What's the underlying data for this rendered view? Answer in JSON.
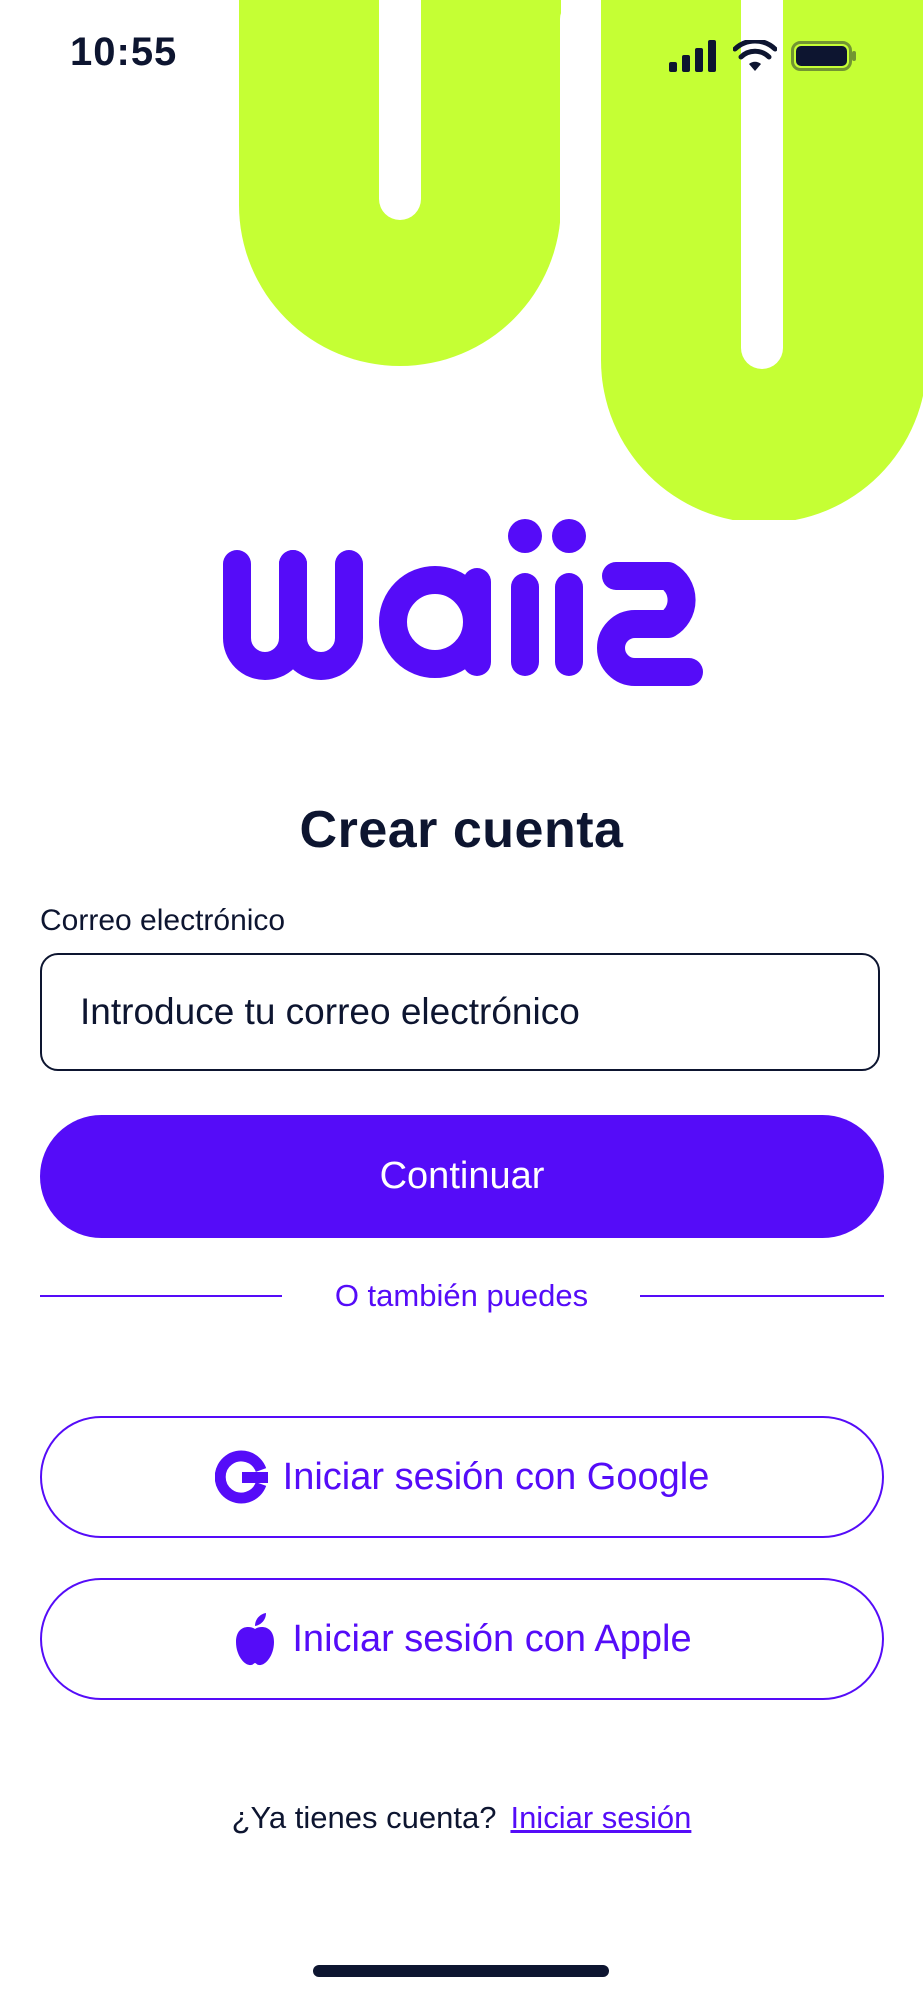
{
  "status_bar": {
    "time": "10:55",
    "icons": [
      "signal-icon",
      "wifi-icon",
      "battery-icon"
    ]
  },
  "brand": {
    "logo_text": "waiis",
    "accent_color": "#550cf8",
    "decor_color": "#c5ff34"
  },
  "page": {
    "title": "Crear cuenta"
  },
  "email": {
    "label": "Correo electrónico",
    "placeholder": "Introduce tu correo electrónico"
  },
  "actions": {
    "continue_label": "Continuar",
    "divider_text": "O también puedes",
    "google_label": "Iniciar sesión con Google",
    "apple_label": "Iniciar sesión con Apple"
  },
  "footer": {
    "prompt": "¿Ya tienes cuenta?",
    "login_link": "Iniciar sesión"
  }
}
